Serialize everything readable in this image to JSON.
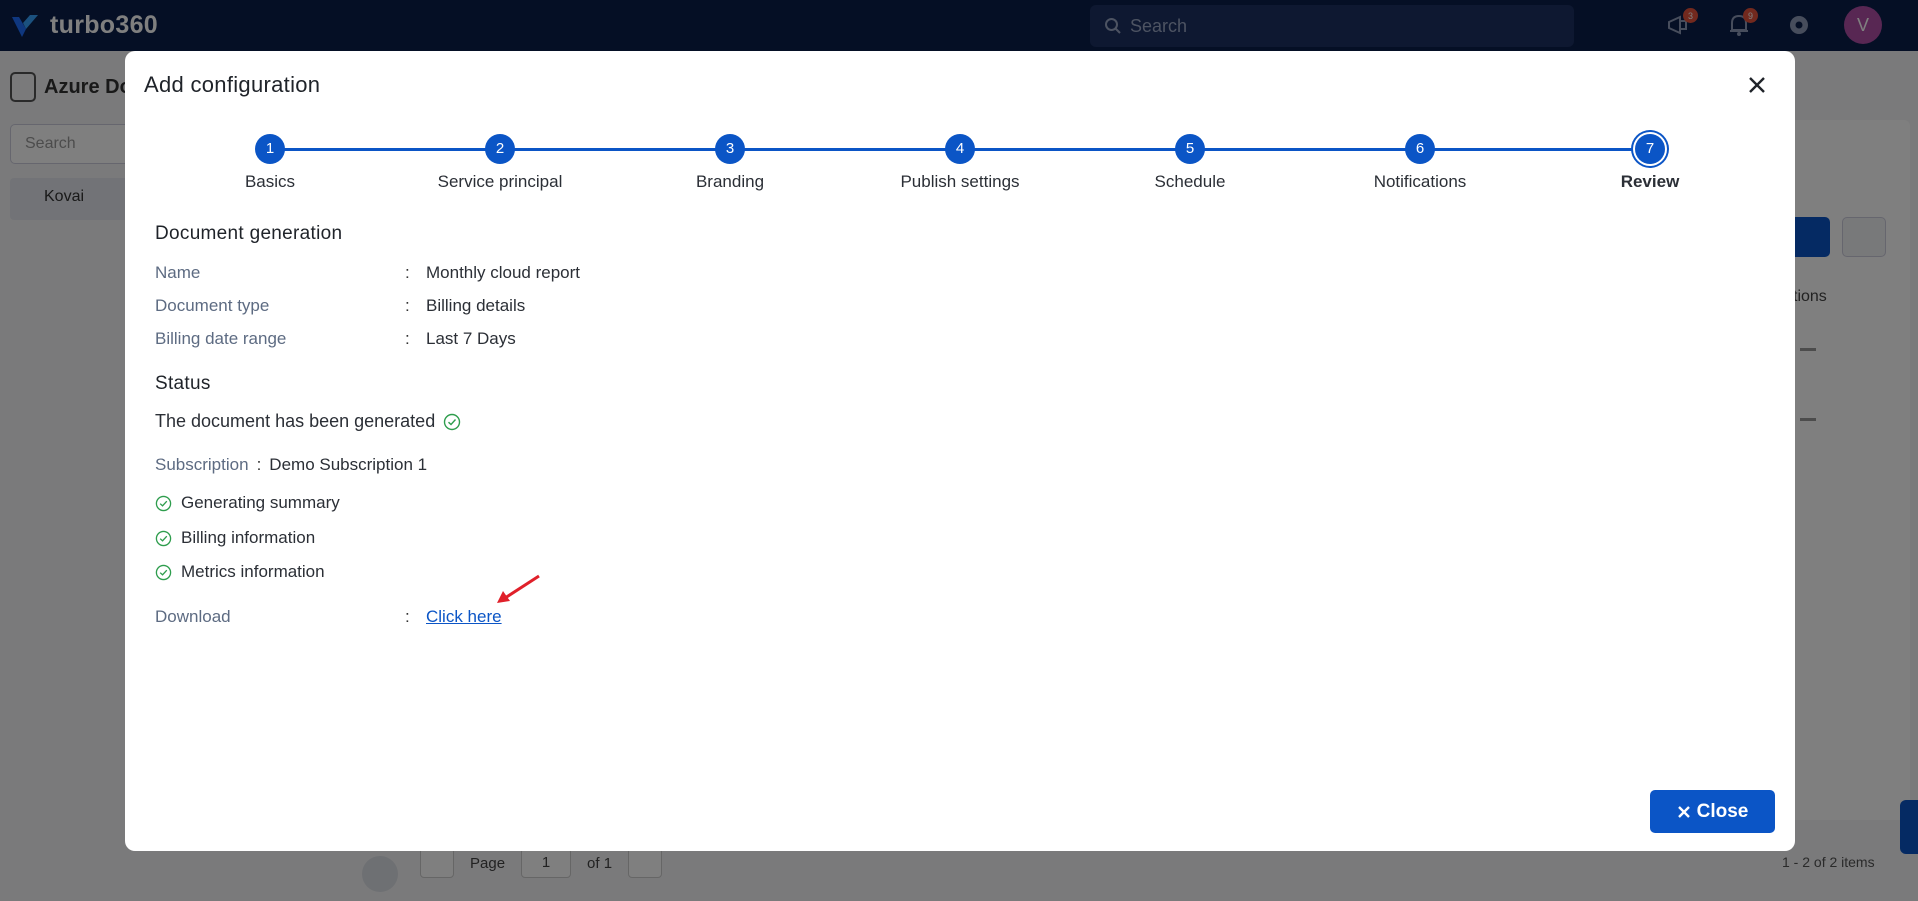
{
  "app": {
    "brand": "turbo360",
    "search_placeholder": "Search",
    "notification_counts": [
      "3",
      "9"
    ],
    "avatar_initial": "V"
  },
  "background": {
    "panel_title": "Azure Do",
    "search_placeholder": "Search",
    "tree_item": "Kovai",
    "column_header": "ctions",
    "pager": {
      "page_label": "Page",
      "page_value": "1",
      "of_label": "of 1"
    },
    "items_count": "1 - 2 of 2 items"
  },
  "modal": {
    "title": "Add configuration",
    "steps": [
      {
        "number": "1",
        "label": "Basics"
      },
      {
        "number": "2",
        "label": "Service principal"
      },
      {
        "number": "3",
        "label": "Branding"
      },
      {
        "number": "4",
        "label": "Publish settings"
      },
      {
        "number": "5",
        "label": "Schedule"
      },
      {
        "number": "6",
        "label": "Notifications"
      },
      {
        "number": "7",
        "label": "Review"
      }
    ],
    "active_step": 7,
    "document_generation": {
      "heading": "Document generation",
      "rows": [
        {
          "key": "Name",
          "value": "Monthly cloud report"
        },
        {
          "key": "Document type",
          "value": "Billing details"
        },
        {
          "key": "Billing date range",
          "value": "Last 7 Days"
        }
      ]
    },
    "status": {
      "heading": "Status",
      "message": "The document has been generated",
      "subscription_label": "Subscription",
      "subscription_value": "Demo Subscription 1",
      "checks": [
        "Generating summary",
        "Billing information",
        "Metrics information"
      ],
      "download_label": "Download",
      "download_link": "Click here"
    },
    "close_button": "Close",
    "colon": ":"
  },
  "colors": {
    "primary": "#0b55c6",
    "topbar": "#0b1f4b",
    "success": "#2e9d4d",
    "annotation_arrow": "#e0202a"
  }
}
